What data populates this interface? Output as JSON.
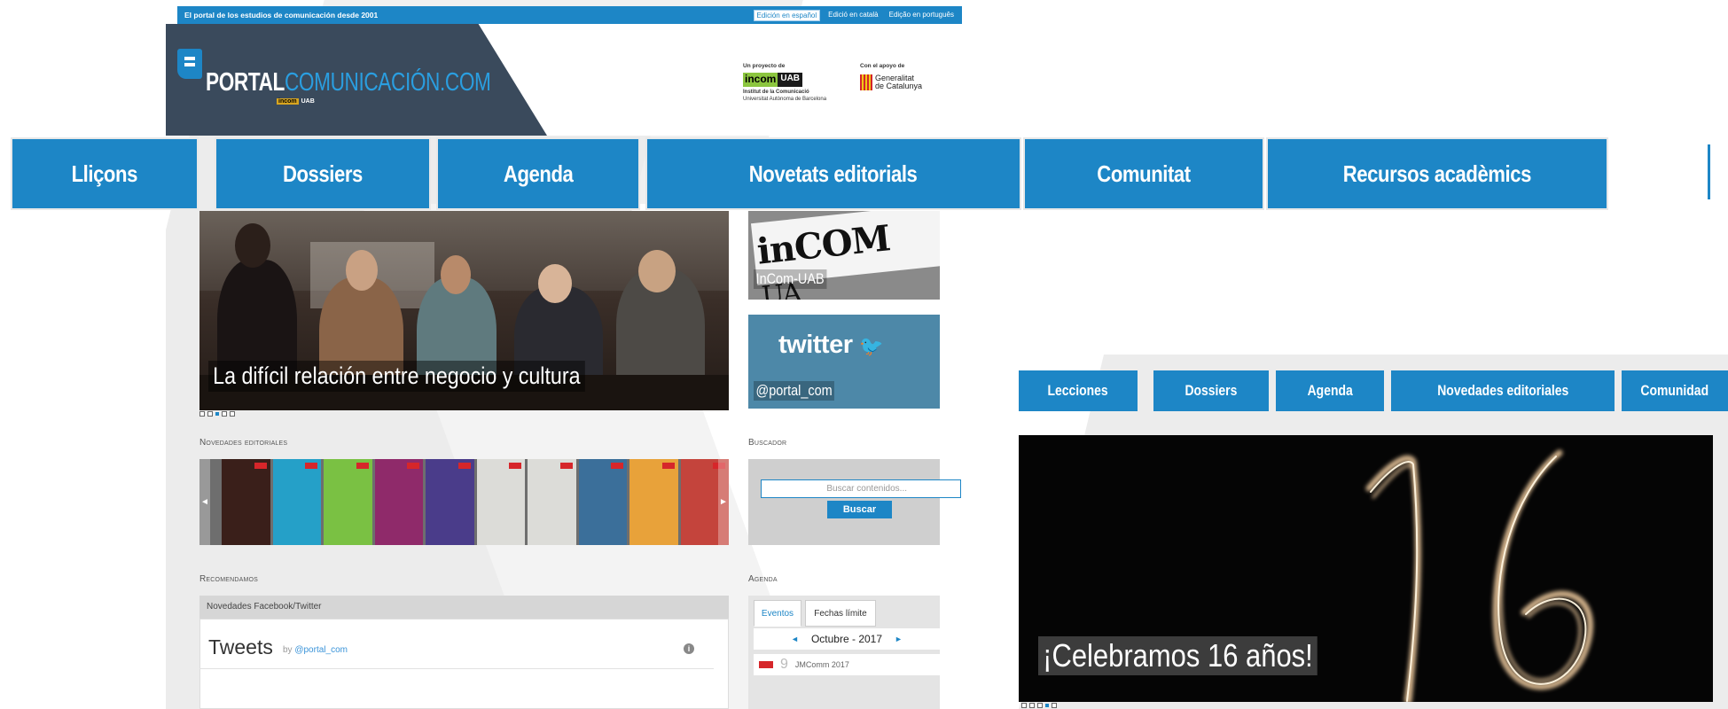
{
  "topbar": {
    "tagline": "El portal de los estudios de comunicación desde 2001",
    "languages": [
      "Edición en español",
      "Edició en català",
      "Edição en português"
    ]
  },
  "header": {
    "logo_white": "PORTAL",
    "logo_blue": "COMUNICACIÓN.COM",
    "logo_sub_in": "incom",
    "logo_sub_uab": "UAB",
    "project_title": "Un proyecto de",
    "project_incom": "incom",
    "project_uab": "UAB",
    "project_line1": "Institut de la Comunicació",
    "project_line2": "Universitat Autònoma de Barcelona",
    "support_title": "Con el apoyo de",
    "support_name_1": "Generalitat",
    "support_name_2": "de Catalunya"
  },
  "bignav": [
    "Lliçons",
    "Dossiers",
    "Agenda",
    "Novetats editorials",
    "Comunitat",
    "Recursos acadèmics"
  ],
  "slider": {
    "caption": "La difícil relación entre negocio y cultura"
  },
  "sidebar": {
    "incom_word": "inCOM",
    "incom_uab": "UA",
    "incom_label": "InCom-UAB",
    "twitter_logo": "twitter",
    "twitter_label": "@portal_com"
  },
  "sections": {
    "novedades": "Novedades editoriales",
    "buscador": "Buscador",
    "recomendamos": "Recomendamos",
    "agenda": "Agenda"
  },
  "search": {
    "placeholder": "Buscar contenidos...",
    "button": "Buscar"
  },
  "recommend": {
    "header": "Novedades Facebook/Twitter",
    "tweets": "Tweets",
    "by": "by",
    "handle": "@portal_com",
    "info": "i"
  },
  "agenda": {
    "tab_events": "Eventos",
    "tab_deadlines": "Fechas límite",
    "month": "Octubre - 2017",
    "prev": "◄",
    "next": "►",
    "event_day": "9",
    "event_name": "JMComm 2017"
  },
  "carousel": {
    "prev": "◄",
    "next": "►"
  },
  "smallnav": [
    "Lecciones",
    "Dossiers",
    "Agenda",
    "Novedades editoriales",
    "Comunidad"
  ],
  "hero": {
    "caption": "¡Celebramos 16 años!"
  },
  "colors": {
    "brand_blue": "#1d86c6",
    "header_dark": "#3a4a5c",
    "incom_green": "#8cc63f"
  },
  "book_colors": [
    "#3a1f1a",
    "#25a0c8",
    "#7ac143",
    "#8f2a6a",
    "#4a3c8a",
    "#dcdcd8",
    "#dcdcd8",
    "#3b6f9a",
    "#e8a23a",
    "#c4443c"
  ]
}
